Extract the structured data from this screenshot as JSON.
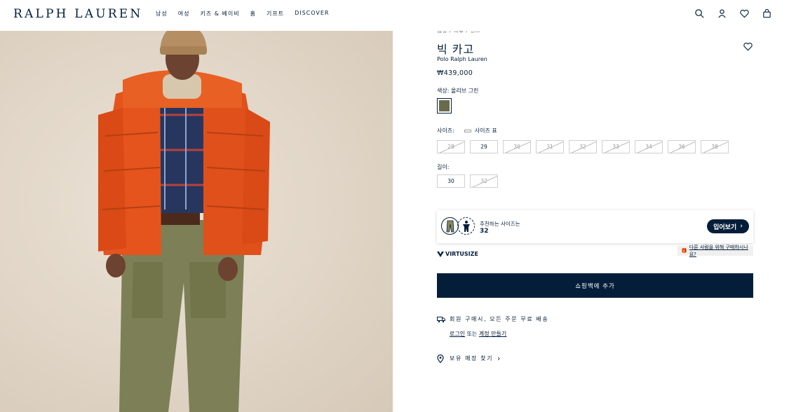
{
  "header": {
    "logo": "RALPH LAUREN",
    "nav": [
      "남성",
      "여성",
      "키즈 & 베이비",
      "홈",
      "기프트",
      "DISCOVER"
    ]
  },
  "breadcrumb": "캠핑 / 의류 / 팬츠",
  "product": {
    "title": "빅 카고",
    "brand": "Polo Ralph Lauren",
    "price": "₩439,000",
    "color_label": "색상: 올리브 그린",
    "color_hex": "#6a6b4a",
    "size_label": "사이즈:",
    "size_chart": "사이즈 표",
    "sizes": [
      {
        "label": "28",
        "available": false
      },
      {
        "label": "29",
        "available": true
      },
      {
        "label": "30",
        "available": false
      },
      {
        "label": "31",
        "available": false
      },
      {
        "label": "32",
        "available": false
      },
      {
        "label": "33",
        "available": false
      },
      {
        "label": "34",
        "available": false
      },
      {
        "label": "36",
        "available": false
      },
      {
        "label": "38",
        "available": false
      }
    ],
    "length_label": "길이:",
    "lengths": [
      {
        "label": "30",
        "available": true
      },
      {
        "label": "32",
        "available": false
      }
    ]
  },
  "virtusize": {
    "recommend_text": "추천하는 사이즈는",
    "recommend_size": "32",
    "try_button": "입어보기",
    "brand": "VIRTUSIZE",
    "help_text": "다른 사람을 위해 구매하시나요?"
  },
  "add_to_bag": "쇼핑백에 추가",
  "shipping": {
    "text": "회원 구매시, 모든 주문 무료 배송",
    "login": "로그인",
    "or": "또는",
    "create": "계정 만들기"
  },
  "store": "보유 매장 찾기",
  "colors": {
    "navy": "#041e3a",
    "jacket": "#e5541d",
    "pants": "#7d7f56"
  }
}
